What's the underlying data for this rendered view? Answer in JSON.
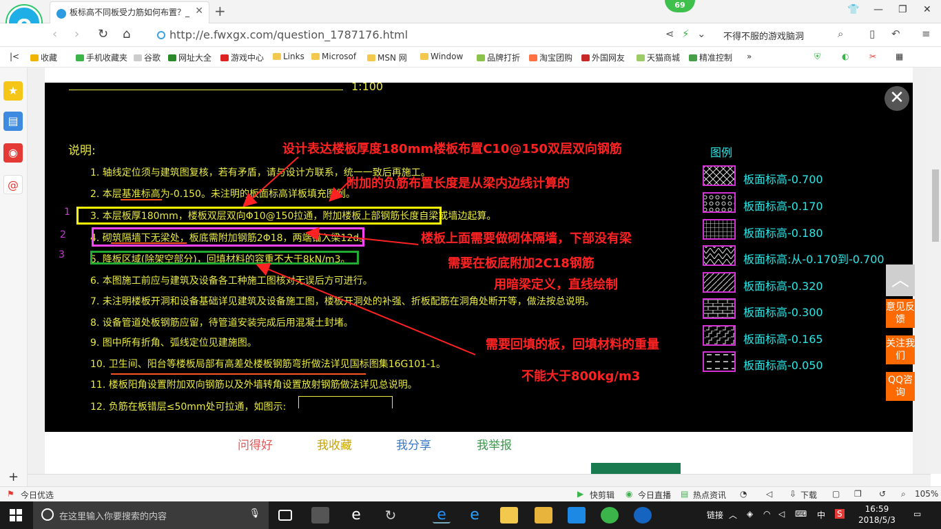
{
  "browser": {
    "tab_title": "板标高不同板受力筋如何布置？_",
    "badge_count": "69",
    "url": "http://e.fwxgx.com/question_1787176.html",
    "search_text": "不得不服的游戏脑洞"
  },
  "bookmarks": [
    "收藏",
    "手机收藏夹",
    "谷歌",
    "网址大全",
    "游戏中心",
    "Links",
    "Microsof",
    "MSN 网",
    "Window",
    "品牌打折",
    "淘宝团购",
    "外国网友",
    "天猫商城",
    "精准控制"
  ],
  "viewer": {
    "title_partial": "1:100",
    "heading": "说明:",
    "notes": [
      "1. 轴线定位须与建筑图复核，若有矛盾，请与设计方联系，统一一致后再施工。",
      "2. 本层基准标高为-0.150。未注明的板面标高详板填充图例。",
      "3. 本层板厚180mm，楼板双层双向Φ10@150拉通，附加楼板上部钢筋长度自梁或墙边起算。",
      "4. 砌筑隔墙下无梁处，板底需附加钢筋2Φ18，两端锚入梁12d。",
      "5. 降板区域(除架空部分)，回填材料的容重不大于8kN/m3。",
      "6. 本图施工前应与建筑及设备各工种施工图核对无误后方可进行。",
      "7. 未注明楼板开洞和设备基础详见建筑及设备施工图，楼板开洞处的补强、折板配筋在洞角处断开等，做法按总说明。",
      "8. 设备管道处板钢筋应留，待管道安装完成后用混凝土封堵。",
      "9. 图中所有折角、弧线定位见建施图。",
      "10. 卫生间、阳台等楼板局部有高差处楼板钢筋弯折做法详见国标图集16G101-1。",
      "11. 楼板阳角设置附加双向钢筋以及外墙转角设置放射钢筋做法详见总说明。",
      "12. 负筋在板错层≤50mm处可拉通，如图示:"
    ],
    "markers": [
      "1",
      "2",
      "3"
    ],
    "annotations": [
      "设计表达楼板厚度180mm楼板布置C10@150双层双向钢筋",
      "附加的负筋布置长度是从梁内边线计算的",
      "楼板上面需要做砌体隔墙，下部没有梁",
      "需要在板底附加2C18钢筋",
      "用暗梁定义，直线绘制",
      "需要回填的板，回填材料的重量",
      "不能大于800kg/m3"
    ],
    "legend_title": "图例",
    "legend": [
      {
        "label": "板面标高-0.700",
        "pattern": "cross"
      },
      {
        "label": "板面标高-0.170",
        "pattern": "circles"
      },
      {
        "label": "板面标高-0.180",
        "pattern": "grid"
      },
      {
        "label": "板面标高:从-0.170到-0.700",
        "pattern": "zigzag"
      },
      {
        "label": "板面标高-0.320",
        "pattern": "diag"
      },
      {
        "label": "板面标高-0.300",
        "pattern": "brick"
      },
      {
        "label": "板面标高-0.165",
        "pattern": "step"
      },
      {
        "label": "板面标高-0.050",
        "pattern": "dash"
      }
    ]
  },
  "page_actions": [
    "问得好",
    "我收藏",
    "我分享",
    "我举报"
  ],
  "right_buttons": [
    "意见反馈",
    "关注我们",
    "QQ咨询"
  ],
  "status": {
    "left": "今日优选",
    "items": [
      "快剪辑",
      "今日直播",
      "热点资讯",
      "下载"
    ],
    "zoom": "105%"
  },
  "taskbar": {
    "search_placeholder": "在这里输入你要搜索的内容",
    "link_label": "链接",
    "ime": "中",
    "time": "16:59",
    "date": "2018/5/3"
  },
  "colors": {
    "annotation_red": "#ff2222",
    "cad_yellow": "#eaea44",
    "legend_cyan": "#2ee6e6",
    "box_yellow": "#ffff00",
    "box_magenta": "#ff44ff",
    "box_green": "#22aa33",
    "accent_orange": "#ff6a00"
  }
}
